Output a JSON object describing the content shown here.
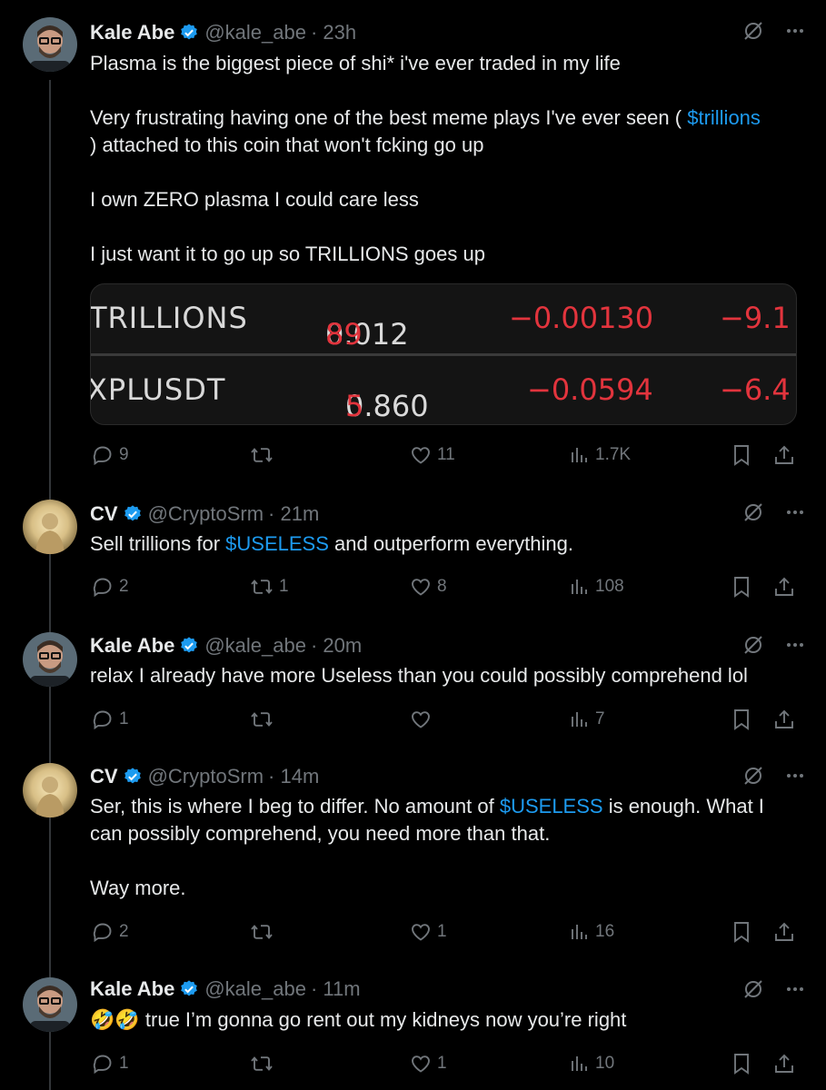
{
  "tweets": [
    {
      "name": "Kale Abe",
      "handle": "@kale_abe",
      "time": "· 23h",
      "lines": [
        [
          "Plasma is the biggest piece of shi* i've ever traded in my life"
        ],
        [
          "Very frustrating having one of the best meme plays I've ever seen ( ",
          "$trillions"
        ],
        [
          ") attached to this coin that won't fcking go up"
        ],
        [
          "I own ZERO plasma I could care less"
        ],
        [
          "I just want it to go up so TRILLIONS goes up"
        ]
      ],
      "replies": "9",
      "reposts": "",
      "likes": "11",
      "views": "1.7K"
    },
    {
      "name": "CV",
      "handle": "@CryptoSrm",
      "time": "· 21m",
      "text_before": "Sell trillions for ",
      "mention": "$USELESS",
      "text_after": " and outperform everything.",
      "replies": "2",
      "reposts": "1",
      "likes": "8",
      "views": "108"
    },
    {
      "name": "Kale Abe",
      "handle": "@kale_abe",
      "time": "· 20m",
      "text": "relax I already have more Useless than you could possibly comprehend lol",
      "replies": "1",
      "reposts": "",
      "likes": "",
      "views": "7"
    },
    {
      "name": "CV",
      "handle": "@CryptoSrm",
      "time": "· 14m",
      "text_before": "Ser, this is where I beg to differ. No amount of ",
      "mention": "$USELESS",
      "text_after": " is enough. What I",
      "line2": "can possibly comprehend, you need more than that.",
      "line3": "Way more.",
      "replies": "2",
      "reposts": "",
      "likes": "1",
      "views": "16"
    },
    {
      "name": "Kale Abe",
      "handle": "@kale_abe",
      "time": "· 11m",
      "emoji": "🤣🤣",
      "text": " true I’m gonna go rent out my kidneys now you’re right",
      "replies": "1",
      "reposts": "",
      "likes": "1",
      "views": "10"
    }
  ],
  "ticker": {
    "rows": [
      {
        "symbol": "TRILLIONS",
        "price_main": "0.012",
        "price_tail": "89",
        "change": "−0.00130",
        "pct": "−9.1"
      },
      {
        "symbol": "XPLUSDT",
        "price_main": "0.860",
        "price_tail": "5",
        "change": "−0.0594",
        "pct": "−6.4"
      }
    ]
  },
  "colors": {
    "background": "#000000",
    "text": "#e7e9ea",
    "muted": "#71767b",
    "link": "#1d9bf0",
    "negative": "#e2343d",
    "verified": "#1d9bf0"
  }
}
